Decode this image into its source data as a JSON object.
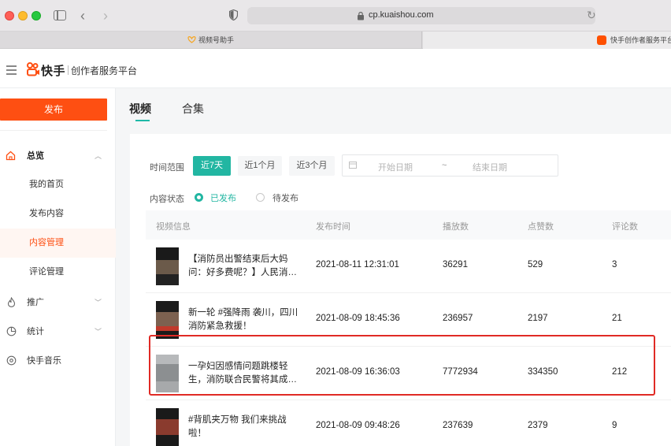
{
  "browser": {
    "url": "cp.kuaishou.com",
    "tabs": [
      {
        "label": "视频号助手"
      },
      {
        "label": "快手创作者服务平台"
      }
    ]
  },
  "header": {
    "logo_text": "快手",
    "platform_name": "创作者服务平台"
  },
  "sidebar": {
    "publish_label": "发布",
    "groups": [
      {
        "label": "总览",
        "icon": "home-icon"
      },
      {
        "label": "推广",
        "icon": "flame-icon"
      },
      {
        "label": "统计",
        "icon": "pie-chart-icon"
      },
      {
        "label": "快手音乐",
        "icon": "music-icon"
      }
    ],
    "sub_items": [
      {
        "label": "我的首页"
      },
      {
        "label": "发布内容"
      },
      {
        "label": "内容管理"
      },
      {
        "label": "评论管理"
      }
    ]
  },
  "main": {
    "tabs": [
      {
        "label": "视频"
      },
      {
        "label": "合集"
      }
    ],
    "filters": {
      "time_range_label": "时间范围",
      "chips": [
        "近7天",
        "近1个月",
        "近3个月"
      ],
      "start_placeholder": "开始日期",
      "range_separator": "~",
      "end_placeholder": "结束日期",
      "status_label": "内容状态",
      "status_options": [
        "已发布",
        "待发布"
      ]
    },
    "table": {
      "columns": [
        "视频信息",
        "发布时间",
        "播放数",
        "点赞数",
        "评论数"
      ],
      "rows": [
        {
          "title": "【消防员出警结束后大妈问：好多费呢？】人民消…",
          "time": "2021-08-11 12:31:01",
          "plays": "36291",
          "likes": "529",
          "comments": "3"
        },
        {
          "title": "新一轮 #强降雨 袭川，四川消防紧急救援！",
          "time": "2021-08-09 18:45:36",
          "plays": "236957",
          "likes": "2197",
          "comments": "21"
        },
        {
          "title": "一孕妇因感情问题跳楼轻生，消防联合民警将其成…",
          "time": "2021-08-09 16:36:03",
          "plays": "7772934",
          "likes": "334350",
          "comments": "212"
        },
        {
          "title": "#背肌夹万物 我们来挑战啦！",
          "time": "2021-08-09 09:48:26",
          "plays": "237639",
          "likes": "2379",
          "comments": "9"
        }
      ]
    }
  },
  "colors": {
    "brand_orange": "#fe4f12",
    "accent_teal": "#22b6a2",
    "highlight_red": "#e02a25"
  }
}
